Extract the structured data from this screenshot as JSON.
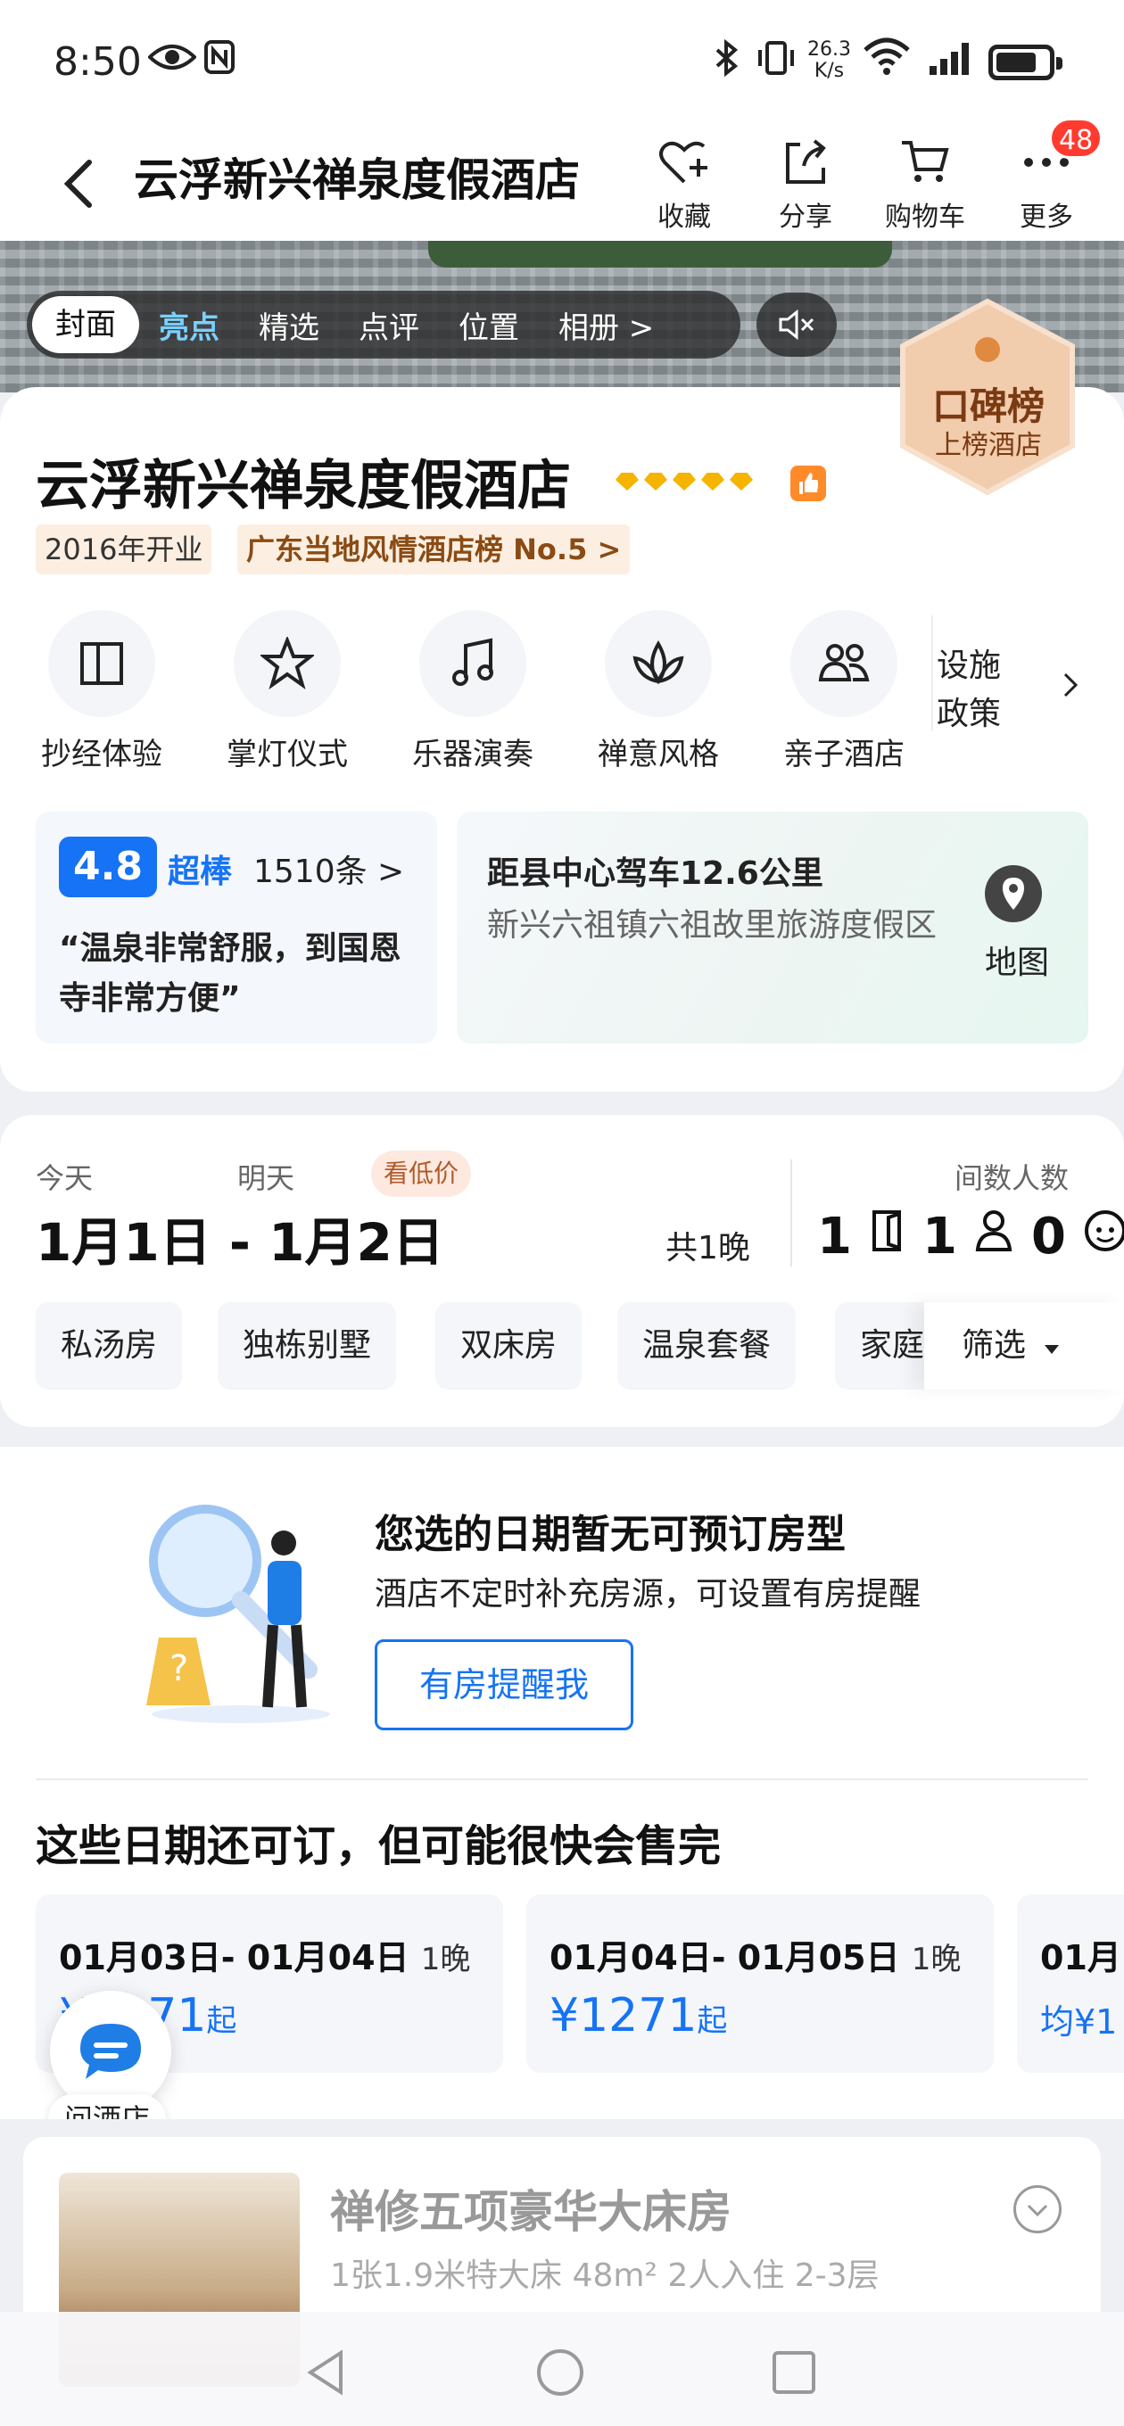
{
  "status_bar": {
    "time": "8:50",
    "net_speed": "26.3\nK/s",
    "signal_label": "6"
  },
  "header": {
    "title": "云浮新兴禅泉度假酒店",
    "actions": [
      {
        "label": "收藏",
        "icon": "heart-plus-icon"
      },
      {
        "label": "分享",
        "icon": "share-icon"
      },
      {
        "label": "购物车",
        "icon": "cart-icon"
      },
      {
        "label": "更多",
        "icon": "more-icon"
      }
    ],
    "badge": "48"
  },
  "hero": {
    "tabs": [
      "封面",
      "亮点",
      "精选",
      "点评",
      "位置",
      "相册 >"
    ],
    "rank_badge": {
      "title": "口碑榜",
      "subtitle": "上榜酒店"
    }
  },
  "hotel": {
    "name": "云浮新兴禅泉度假酒店",
    "stars": 5,
    "opened": "2016年开业",
    "rank": "广东当地风情酒店榜 No.5 >",
    "features": [
      {
        "label": "抄经体验",
        "icon": "book-icon"
      },
      {
        "label": "掌灯仪式",
        "icon": "star-icon"
      },
      {
        "label": "乐器演奏",
        "icon": "music-note-icon"
      },
      {
        "label": "禅意风格",
        "icon": "lotus-icon"
      },
      {
        "label": "亲子酒店",
        "icon": "family-icon"
      }
    ],
    "policy_label": "设施\n政策"
  },
  "rating": {
    "score": "4.8",
    "word": "超棒",
    "count": "1510条 >",
    "quote": "“温泉非常舒服，到国恩寺非常方便”"
  },
  "location": {
    "distance": "距县中心驾车12.6公里",
    "address": "新兴六祖镇六祖故里旅游度假区",
    "map_label": "地图"
  },
  "booking": {
    "today_label": "今天",
    "tomorrow_label": "明天",
    "low_price": "看低价",
    "dates": "1月1日 - 1月2日",
    "nights": "共1晚",
    "guests_label": "间数人数",
    "rooms": "1",
    "adults": "1",
    "children": "0",
    "room_filters": [
      "私汤房",
      "独栋别墅",
      "双床房",
      "温泉套餐",
      "家庭"
    ],
    "filter_label": "筛选"
  },
  "empty": {
    "title": "您选的日期暂无可预订房型",
    "subtitle": "酒店不定时补充房源，可设置有房提醒",
    "button": "有房提醒我"
  },
  "available": {
    "title": "这些日期还可订，但可能很快会售完",
    "cards": [
      {
        "dates": "01月03日- 01月04日",
        "nights": "1晚",
        "price": "¥1271",
        "suffix": "起"
      },
      {
        "dates": "01月04日- 01月05日",
        "nights": "1晚",
        "price": "¥1271",
        "suffix": "起"
      },
      {
        "dates": "01月",
        "nights": "",
        "price": "均¥1",
        "suffix": ""
      }
    ]
  },
  "ask_hotel": "问酒店",
  "room": {
    "name": "禅修五项豪华大床房",
    "spec": "1张1.9米特大床 48m² 2人入住 2-3层"
  },
  "colors": {
    "accent": "#1673f5",
    "badge_red": "#ff3b30",
    "star_gold": "#f5b400"
  }
}
